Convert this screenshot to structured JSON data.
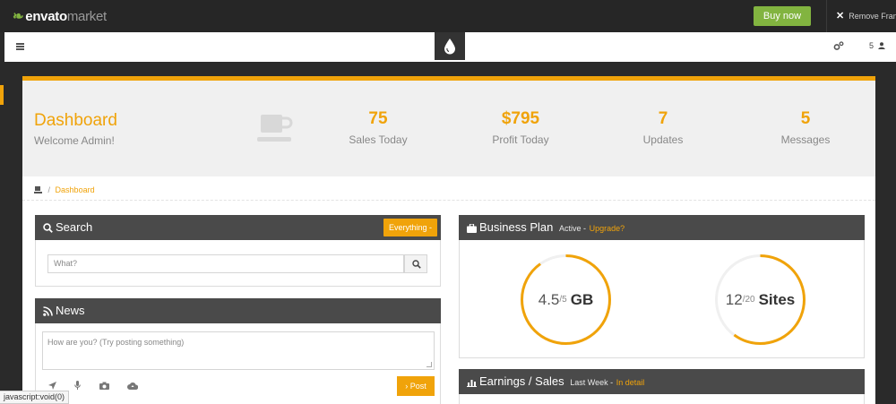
{
  "envato": {
    "logo_envato": "envato",
    "logo_market": "market",
    "buy_label": "Buy now",
    "remove_label": "Remove Frame"
  },
  "header": {
    "user_count": "5"
  },
  "dashboard": {
    "title": "Dashboard",
    "welcome": "Welcome Admin!"
  },
  "stats": [
    {
      "value": "75",
      "label": "Sales Today"
    },
    {
      "value": "$795",
      "label": "Profit Today"
    },
    {
      "value": "7",
      "label": "Updates"
    },
    {
      "value": "5",
      "label": "Messages"
    }
  ],
  "breadcrumb": {
    "separator": "/",
    "current": "Dashboard"
  },
  "search_panel": {
    "title": "Search",
    "scope_label": "Everything -",
    "placeholder": "What?"
  },
  "news_panel": {
    "title": "News",
    "placeholder": "How are you? (Try posting something)",
    "post_label": "› Post"
  },
  "business_panel": {
    "title": "Business Plan",
    "status": "Active -",
    "upgrade_link": "Upgrade?",
    "storage": {
      "used": "4.5",
      "total": "/5",
      "unit": "GB",
      "fraction": 0.9
    },
    "sites": {
      "used": "12",
      "total": "/20",
      "unit": "Sites",
      "fraction": 0.6
    }
  },
  "earnings_panel": {
    "title": "Earnings / Sales",
    "period": "Last Week -",
    "detail_link": "In detail"
  },
  "status_bar": {
    "text": "javascript:void(0)"
  },
  "colors": {
    "accent": "#f0a30a",
    "envato_green": "#82b440",
    "panel_header": "#4a4a4a"
  }
}
